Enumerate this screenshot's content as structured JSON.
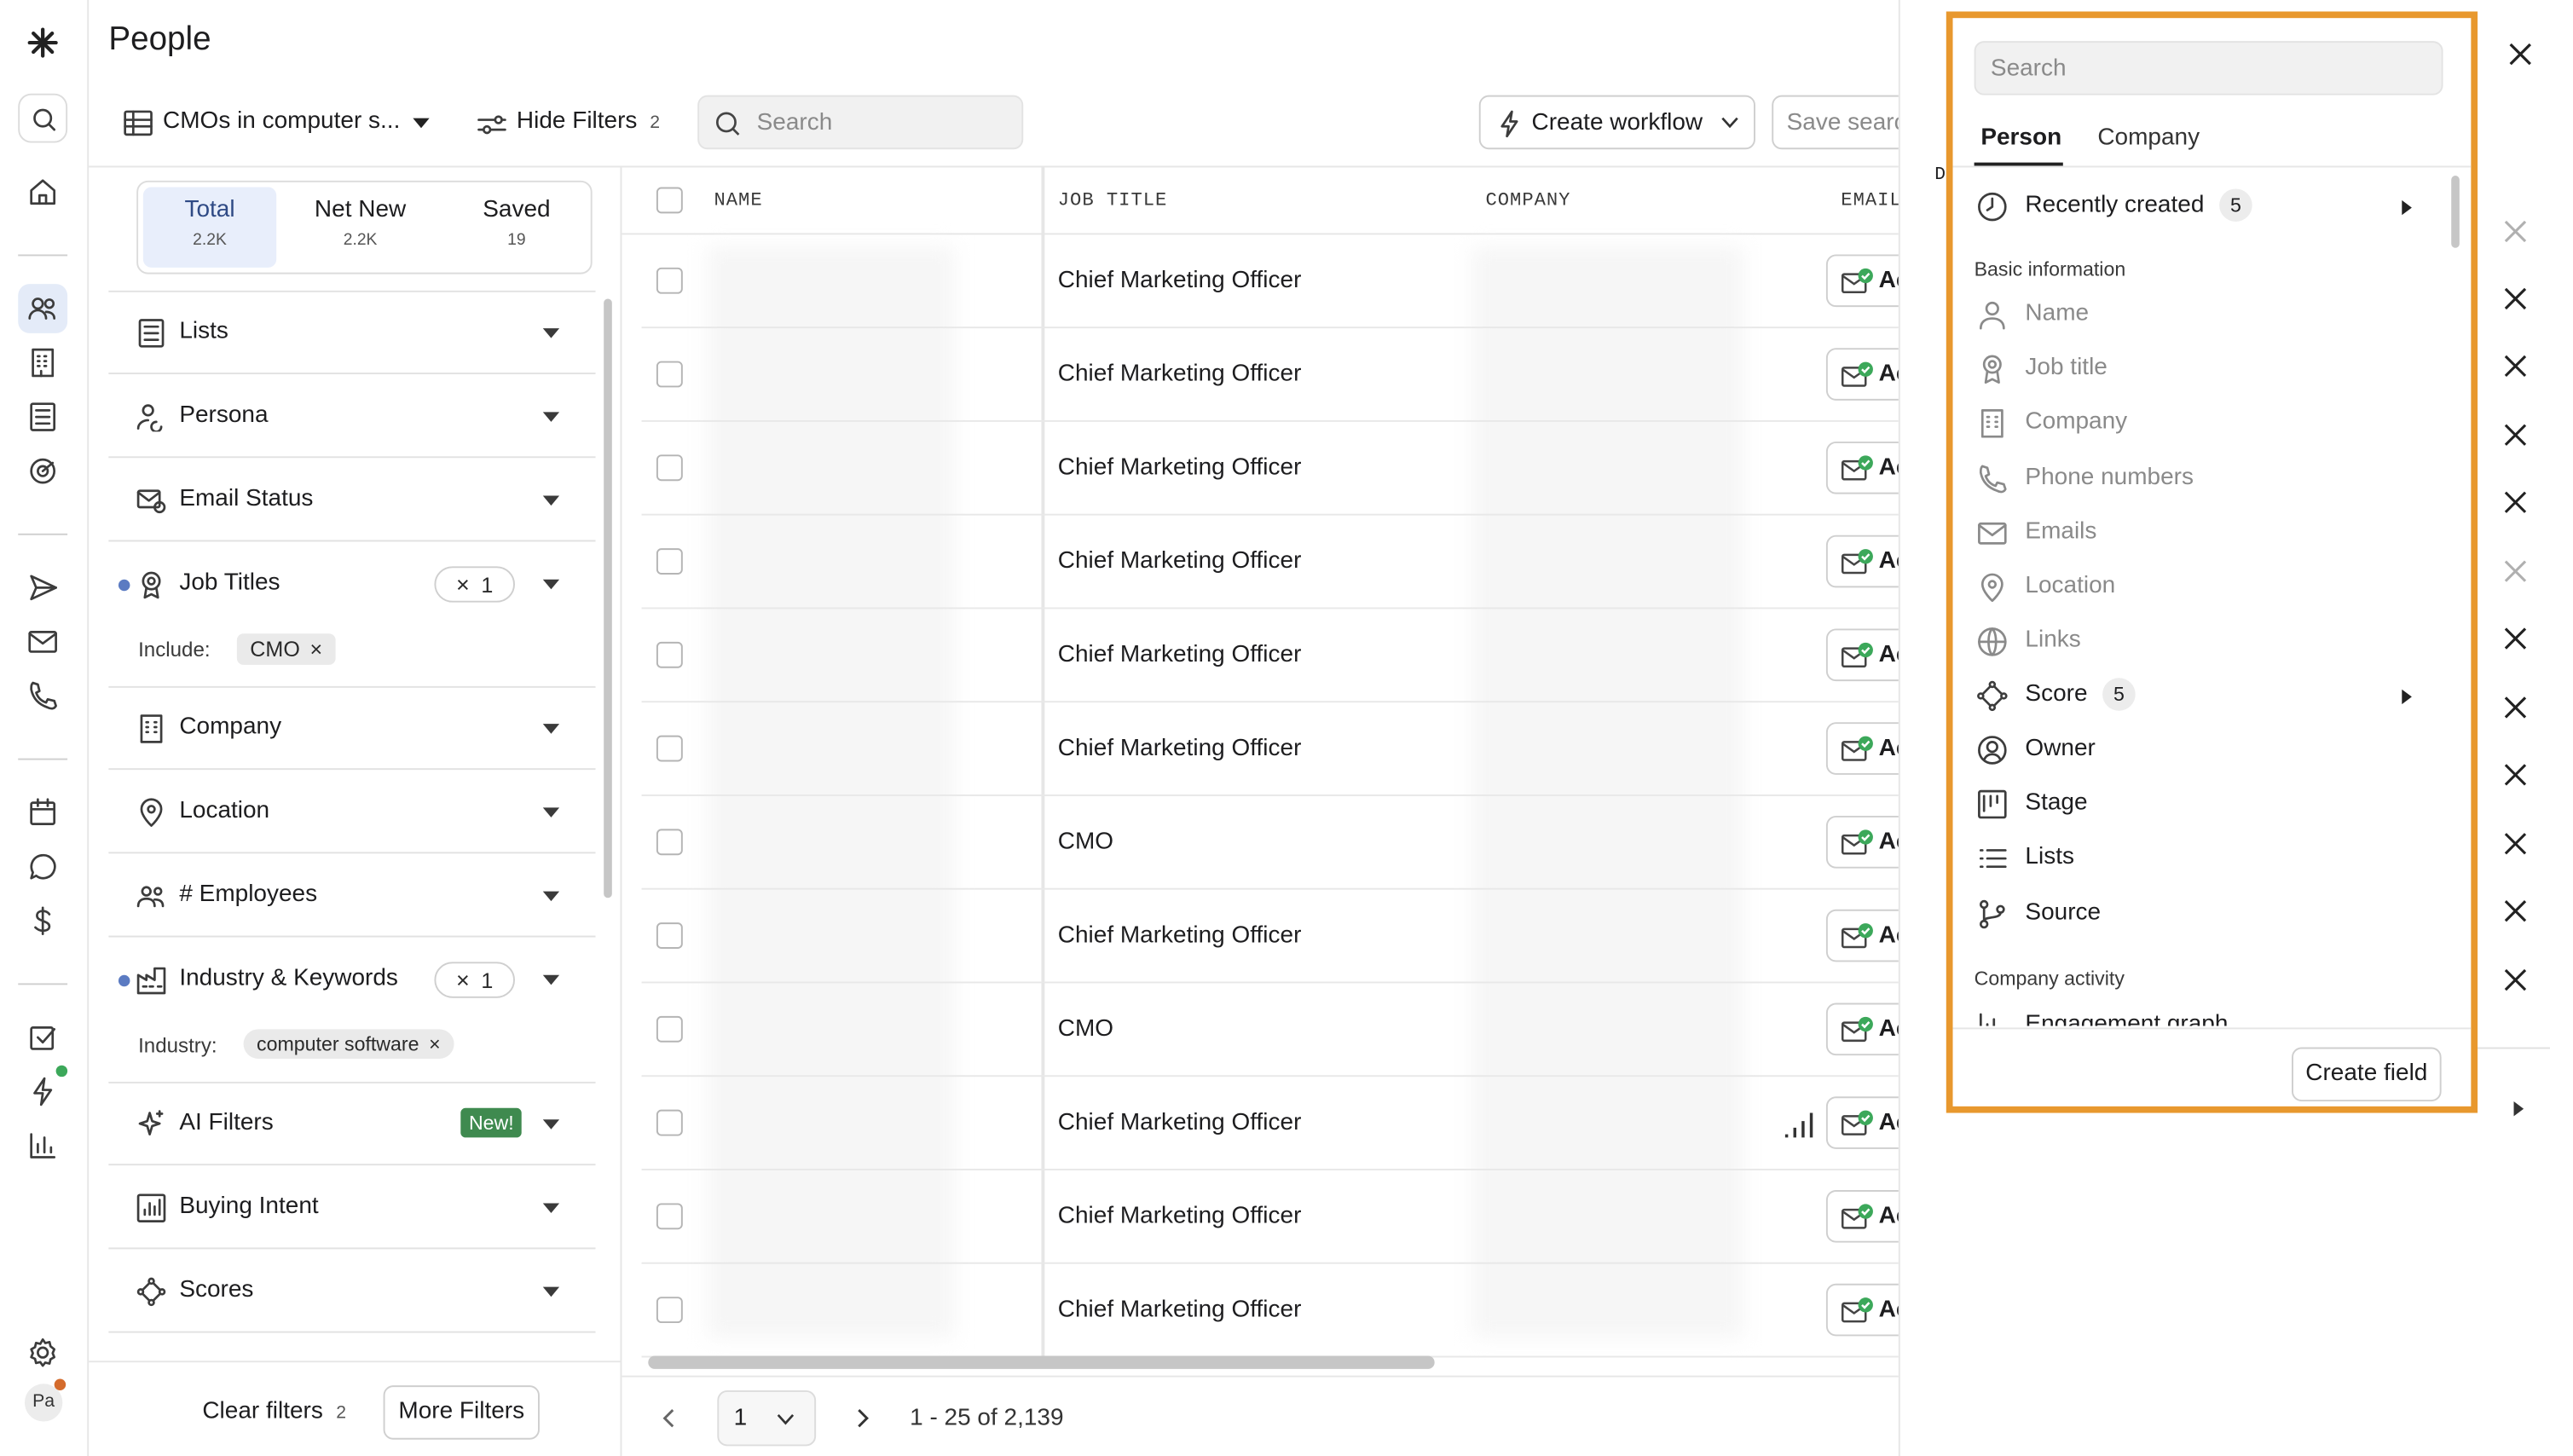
{
  "app": {
    "title": "People"
  },
  "toolbar": {
    "view_name": "CMOs in computer s...",
    "hide_filters_label": "Hide Filters",
    "hide_filters_count": "2",
    "search_placeholder": "Search",
    "create_workflow_label": "Create workflow",
    "save_search_label": "Save searc"
  },
  "tabs": [
    {
      "label": "Total",
      "count": "2.2K",
      "active": true
    },
    {
      "label": "Net New",
      "count": "2.2K"
    },
    {
      "label": "Saved",
      "count": "19"
    }
  ],
  "filters": [
    {
      "label": "Lists",
      "icon": "list-icon"
    },
    {
      "label": "Persona",
      "icon": "persona-icon"
    },
    {
      "label": "Email Status",
      "icon": "email-status-icon"
    },
    {
      "label": "Job Titles",
      "icon": "badge-icon",
      "active": true,
      "count": "1",
      "sub_label": "Include:",
      "chips": [
        "CMO"
      ]
    },
    {
      "label": "Company",
      "icon": "building-icon"
    },
    {
      "label": "Location",
      "icon": "location-icon"
    },
    {
      "label": "# Employees",
      "icon": "people-icon"
    },
    {
      "label": "Industry & Keywords",
      "icon": "industry-icon",
      "active": true,
      "count": "1",
      "sub_label": "Industry:",
      "chips": [
        "computer software"
      ]
    },
    {
      "label": "AI Filters",
      "icon": "sparkle-icon",
      "badge": "New!"
    },
    {
      "label": "Buying Intent",
      "icon": "chart-icon"
    },
    {
      "label": "Scores",
      "icon": "score-icon"
    }
  ],
  "filter_footer": {
    "clear_label": "Clear filters",
    "clear_count": "2",
    "more_label": "More Filters"
  },
  "table": {
    "columns": [
      "NAME",
      "JOB TITLE",
      "COMPANY",
      "EMAIL"
    ],
    "rows": [
      {
        "job_title": "Chief Marketing Officer",
        "email_label": "Ac"
      },
      {
        "job_title": "Chief Marketing Officer",
        "email_label": "Ac"
      },
      {
        "job_title": "Chief Marketing Officer",
        "email_label": "Ac"
      },
      {
        "job_title": "Chief Marketing Officer",
        "email_label": "Ac"
      },
      {
        "job_title": "Chief Marketing Officer",
        "email_label": "Ac"
      },
      {
        "job_title": "Chief Marketing Officer",
        "email_label": "Ac"
      },
      {
        "job_title": "CMO",
        "email_label": "Ac"
      },
      {
        "job_title": "Chief Marketing Officer",
        "email_label": "Ac"
      },
      {
        "job_title": "CMO",
        "email_label": "Ac"
      },
      {
        "job_title": "Chief Marketing Officer",
        "email_label": "Ac"
      },
      {
        "job_title": "Chief Marketing Officer",
        "email_label": "Ac"
      },
      {
        "job_title": "Chief Marketing Officer",
        "email_label": "Ac"
      }
    ]
  },
  "pagination": {
    "page": "1",
    "range": "1 - 25 of 2,139"
  },
  "field_panel": {
    "search_placeholder": "Search",
    "tabs": [
      "Person",
      "Company"
    ],
    "recent": {
      "label": "Recently created",
      "count": "5"
    },
    "section_basic": "Basic information",
    "basic_fields": [
      {
        "label": "Name",
        "icon": "person-icon"
      },
      {
        "label": "Job title",
        "icon": "badge-icon"
      },
      {
        "label": "Company",
        "icon": "building-icon"
      },
      {
        "label": "Phone numbers",
        "icon": "phone-icon"
      },
      {
        "label": "Emails",
        "icon": "mail-icon"
      },
      {
        "label": "Location",
        "icon": "location-icon"
      },
      {
        "label": "Links",
        "icon": "globe-icon"
      }
    ],
    "score": {
      "label": "Score",
      "count": "5"
    },
    "other_fields": [
      {
        "label": "Owner",
        "icon": "user-circle-icon"
      },
      {
        "label": "Stage",
        "icon": "kanban-icon"
      },
      {
        "label": "Lists",
        "icon": "list-icon"
      },
      {
        "label": "Source",
        "icon": "branch-icon"
      }
    ],
    "section_company": "Company activity",
    "partial_item": "Engagement graph",
    "create_label": "Create field"
  },
  "sidebar_user": {
    "initials": "Pa"
  },
  "colors": {
    "highlight_border": "#e8982e",
    "active_tab_bg": "#e8eefb",
    "status_green": "#3ca85a",
    "dot_blue": "#5b7bc2"
  }
}
